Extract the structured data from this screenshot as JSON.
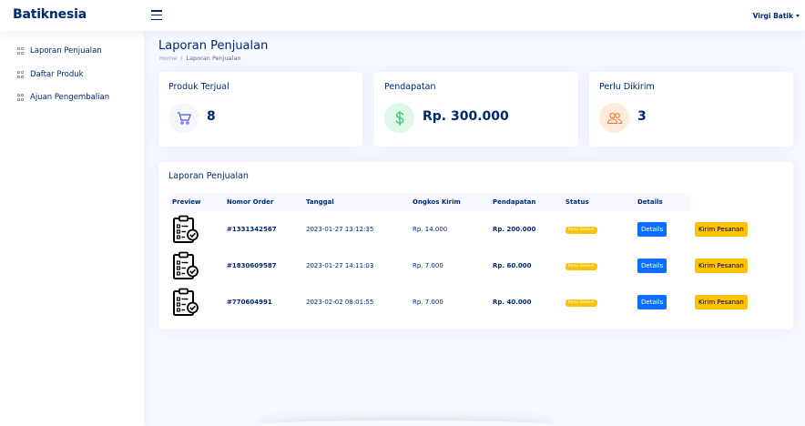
{
  "header": {
    "logo": "Batiknesia",
    "user_name": "Virgi Batik"
  },
  "sidebar": {
    "items": [
      {
        "label": "Laporan Penjualan",
        "icon": "grid-icon"
      },
      {
        "label": "Daftar Produk",
        "icon": "grid-icon"
      },
      {
        "label": "Ajuan Pengembalian",
        "icon": "grid-icon"
      }
    ]
  },
  "page": {
    "title": "Laporan Penjualan",
    "breadcrumb": {
      "home": "Home",
      "separator": "/",
      "current": "Laporan Penjualan"
    }
  },
  "stats": [
    {
      "title": "Produk Terjual",
      "value": "8",
      "icon": "cart-icon",
      "icon_color": "#4154f1",
      "icon_bg": "#f6f6fe"
    },
    {
      "title": "Pendapatan",
      "value": "Rp. 300.000",
      "icon": "dollar-icon",
      "icon_color": "#2eca6a",
      "icon_bg": "#e0f8e9"
    },
    {
      "title": "Perlu Dikirim",
      "value": "3",
      "icon": "people-icon",
      "icon_color": "#ff771d",
      "icon_bg": "#ffecdf"
    }
  ],
  "report": {
    "title": "Laporan Penjualan",
    "columns": [
      "Preview",
      "Nomor Order",
      "Tanggal",
      "Ongkos Kirim",
      "Pendapatan",
      "Status",
      "Details"
    ],
    "rows": [
      {
        "order": "#1331342567",
        "date": "2023-01-27 13:12:35",
        "ongkir": "Rp. 14.000",
        "income": "Rp. 200.000",
        "status": "Perlu Dikirim",
        "details": "Details",
        "action": "Kirim Pesanan"
      },
      {
        "order": "#1830609587",
        "date": "2023-01-27 14:11:03",
        "ongkir": "Rp. 7.000",
        "income": "Rp. 60.000",
        "status": "Perlu Dikirim",
        "details": "Details",
        "action": "Kirim Pesanan"
      },
      {
        "order": "#770604991",
        "date": "2023-02-02 08:01:55",
        "ongkir": "Rp. 7.000",
        "income": "Rp. 40.000",
        "status": "Perlu Dikirim",
        "details": "Details",
        "action": "Kirim Pesanan"
      }
    ]
  }
}
